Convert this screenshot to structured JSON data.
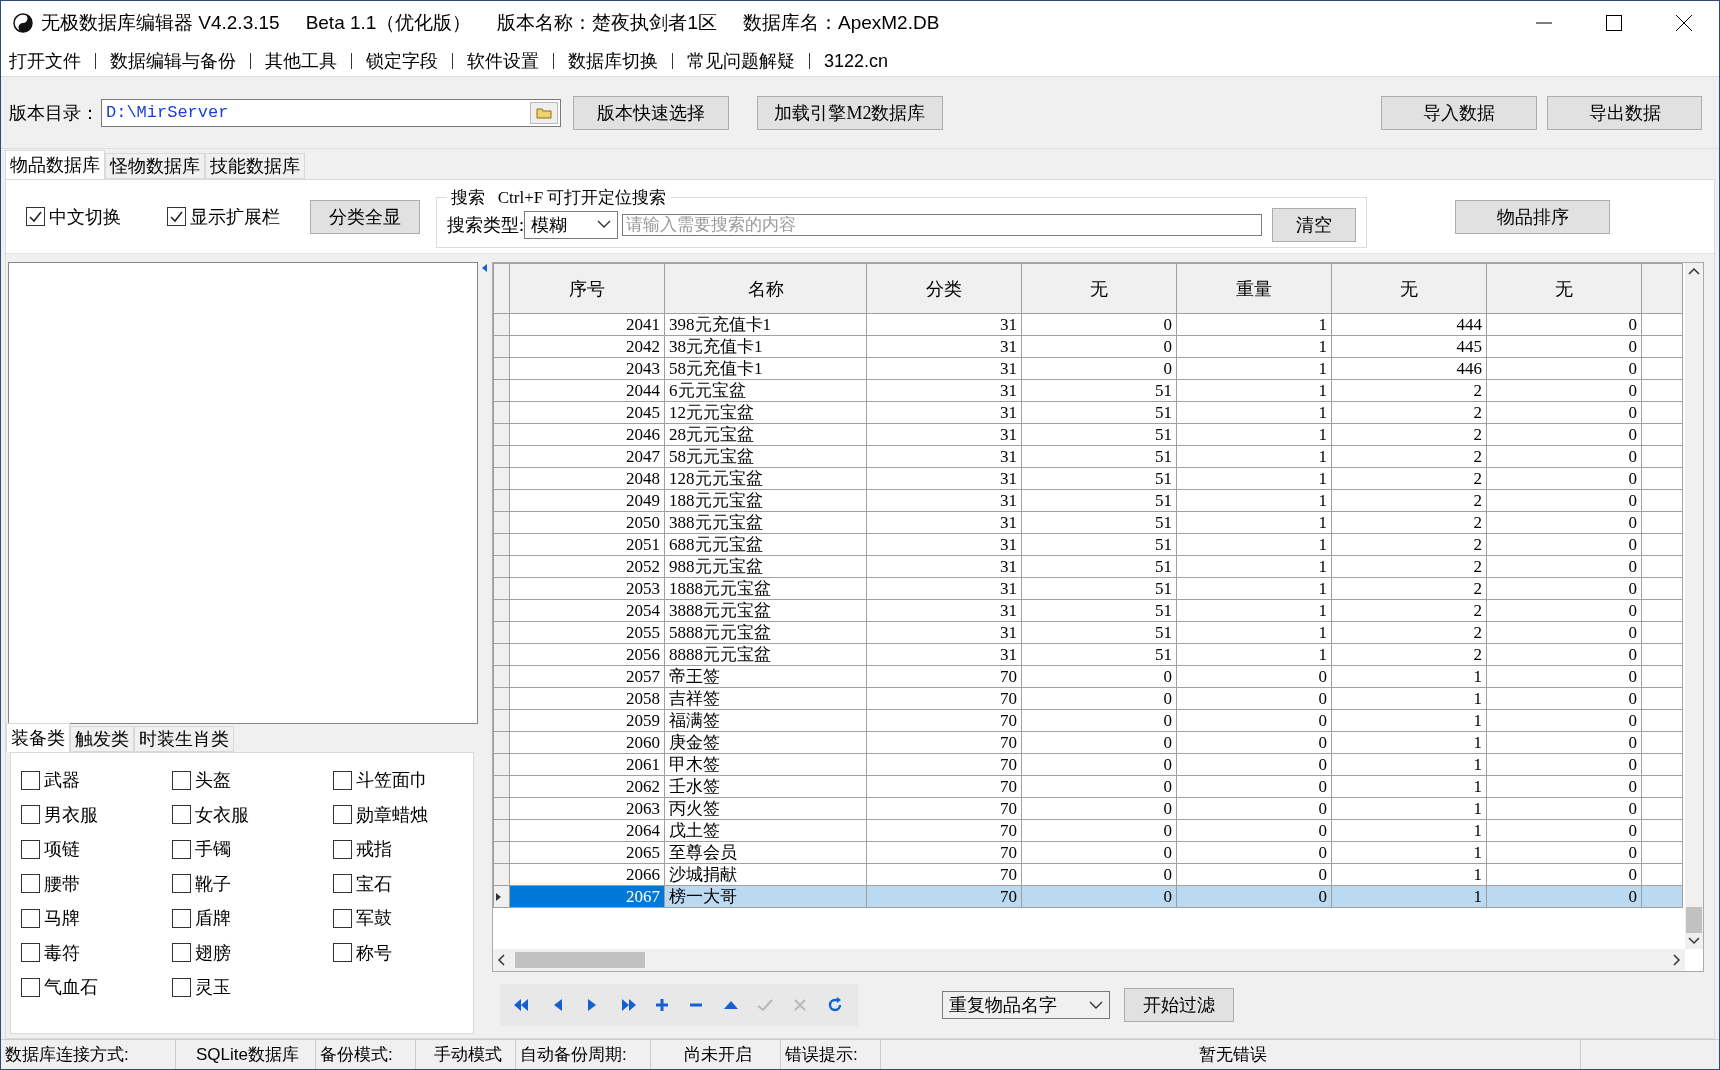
{
  "window": {
    "title_parts": [
      "无极数据库编辑器 V4.2.3.15",
      "Beta 1.1（优化版）",
      "版本名称：楚夜执剑者1区",
      "数据库名：ApexM2.DB"
    ]
  },
  "menu": [
    "打开文件",
    "数据编辑与备份",
    "其他工具",
    "锁定字段",
    "软件设置",
    "数据库切换",
    "常见问题解疑",
    "3122.cn"
  ],
  "toolbar": {
    "path_label": "版本目录：",
    "path_value": "D:\\MirServer",
    "buttons": [
      "版本快速选择",
      "加载引擎M2数据库"
    ],
    "right_buttons": [
      "导入数据",
      "导出数据"
    ]
  },
  "tabs": [
    {
      "label": "物品数据库",
      "selected": true
    },
    {
      "label": "怪物数据库",
      "selected": false
    },
    {
      "label": "技能数据库",
      "selected": false
    }
  ],
  "options": [
    {
      "label": "中文切换",
      "checked": true
    },
    {
      "label": "显示扩展栏",
      "checked": true
    }
  ],
  "show_all_button": "分类全显",
  "search": {
    "legend_label": "搜索",
    "legend_hint": "Ctrl+F 可打开定位搜索",
    "type_label": "搜索类型:",
    "type_value": "模糊",
    "placeholder": "请输入需要搜索的内容",
    "clear_button": "清空"
  },
  "sort_button": "物品排序",
  "category_tabs": [
    {
      "label": "装备类",
      "selected": true
    },
    {
      "label": "触发类",
      "selected": false
    },
    {
      "label": "时装生肖类",
      "selected": false
    }
  ],
  "categories": [
    {
      "label": "武器",
      "checked": false
    },
    {
      "label": "头盔",
      "checked": false
    },
    {
      "label": "斗笠面巾",
      "checked": false
    },
    {
      "label": "男衣服",
      "checked": false
    },
    {
      "label": "女衣服",
      "checked": false
    },
    {
      "label": "勋章蜡烛",
      "checked": false
    },
    {
      "label": "项链",
      "checked": false
    },
    {
      "label": "手镯",
      "checked": false
    },
    {
      "label": "戒指",
      "checked": false
    },
    {
      "label": "腰带",
      "checked": false
    },
    {
      "label": "靴子",
      "checked": false
    },
    {
      "label": "宝石",
      "checked": false
    },
    {
      "label": "马牌",
      "checked": false
    },
    {
      "label": "盾牌",
      "checked": false
    },
    {
      "label": "军鼓",
      "checked": false
    },
    {
      "label": "毒符",
      "checked": false
    },
    {
      "label": "翅膀",
      "checked": false
    },
    {
      "label": "称号",
      "checked": false
    },
    {
      "label": "气血石",
      "checked": false
    },
    {
      "label": "灵玉",
      "checked": false
    }
  ],
  "table": {
    "columns": [
      "序号",
      "名称",
      "分类",
      "无",
      "重量",
      "无",
      "无"
    ],
    "rows": [
      {
        "cells": [
          "2041",
          "398元充值卡1",
          "31",
          "0",
          "1",
          "444",
          "0"
        ],
        "selected": false
      },
      {
        "cells": [
          "2042",
          "38元充值卡1",
          "31",
          "0",
          "1",
          "445",
          "0"
        ],
        "selected": false
      },
      {
        "cells": [
          "2043",
          "58元充值卡1",
          "31",
          "0",
          "1",
          "446",
          "0"
        ],
        "selected": false
      },
      {
        "cells": [
          "2044",
          "6元元宝盆",
          "31",
          "51",
          "1",
          "2",
          "0"
        ],
        "selected": false
      },
      {
        "cells": [
          "2045",
          "12元元宝盆",
          "31",
          "51",
          "1",
          "2",
          "0"
        ],
        "selected": false
      },
      {
        "cells": [
          "2046",
          "28元元宝盆",
          "31",
          "51",
          "1",
          "2",
          "0"
        ],
        "selected": false
      },
      {
        "cells": [
          "2047",
          "58元元宝盆",
          "31",
          "51",
          "1",
          "2",
          "0"
        ],
        "selected": false
      },
      {
        "cells": [
          "2048",
          "128元元宝盆",
          "31",
          "51",
          "1",
          "2",
          "0"
        ],
        "selected": false
      },
      {
        "cells": [
          "2049",
          "188元元宝盆",
          "31",
          "51",
          "1",
          "2",
          "0"
        ],
        "selected": false
      },
      {
        "cells": [
          "2050",
          "388元元宝盆",
          "31",
          "51",
          "1",
          "2",
          "0"
        ],
        "selected": false
      },
      {
        "cells": [
          "2051",
          "688元元宝盆",
          "31",
          "51",
          "1",
          "2",
          "0"
        ],
        "selected": false
      },
      {
        "cells": [
          "2052",
          "988元元宝盆",
          "31",
          "51",
          "1",
          "2",
          "0"
        ],
        "selected": false
      },
      {
        "cells": [
          "2053",
          "1888元元宝盆",
          "31",
          "51",
          "1",
          "2",
          "0"
        ],
        "selected": false
      },
      {
        "cells": [
          "2054",
          "3888元元宝盆",
          "31",
          "51",
          "1",
          "2",
          "0"
        ],
        "selected": false
      },
      {
        "cells": [
          "2055",
          "5888元元宝盆",
          "31",
          "51",
          "1",
          "2",
          "0"
        ],
        "selected": false
      },
      {
        "cells": [
          "2056",
          "8888元元宝盆",
          "31",
          "51",
          "1",
          "2",
          "0"
        ],
        "selected": false
      },
      {
        "cells": [
          "2057",
          "帝王签",
          "70",
          "0",
          "0",
          "1",
          "0"
        ],
        "selected": false
      },
      {
        "cells": [
          "2058",
          "吉祥签",
          "70",
          "0",
          "0",
          "1",
          "0"
        ],
        "selected": false
      },
      {
        "cells": [
          "2059",
          "福满签",
          "70",
          "0",
          "0",
          "1",
          "0"
        ],
        "selected": false
      },
      {
        "cells": [
          "2060",
          "庚金签",
          "70",
          "0",
          "0",
          "1",
          "0"
        ],
        "selected": false
      },
      {
        "cells": [
          "2061",
          "甲木签",
          "70",
          "0",
          "0",
          "1",
          "0"
        ],
        "selected": false
      },
      {
        "cells": [
          "2062",
          "壬水签",
          "70",
          "0",
          "0",
          "1",
          "0"
        ],
        "selected": false
      },
      {
        "cells": [
          "2063",
          "丙火签",
          "70",
          "0",
          "0",
          "1",
          "0"
        ],
        "selected": false
      },
      {
        "cells": [
          "2064",
          "戊土签",
          "70",
          "0",
          "0",
          "1",
          "0"
        ],
        "selected": false
      },
      {
        "cells": [
          "2065",
          "至尊会员",
          "70",
          "0",
          "0",
          "1",
          "0"
        ],
        "selected": false
      },
      {
        "cells": [
          "2066",
          "沙城捐献",
          "70",
          "0",
          "0",
          "1",
          "0"
        ],
        "selected": false
      },
      {
        "cells": [
          "2067",
          "榜一大哥",
          "70",
          "0",
          "0",
          "1",
          "0"
        ],
        "selected": true
      }
    ]
  },
  "navigator": [
    {
      "kind": "first",
      "disabled": false
    },
    {
      "kind": "prior",
      "disabled": false
    },
    {
      "kind": "next",
      "disabled": false
    },
    {
      "kind": "last",
      "disabled": false
    },
    {
      "kind": "insert",
      "disabled": false
    },
    {
      "kind": "delete",
      "disabled": false
    },
    {
      "kind": "edit",
      "disabled": false
    },
    {
      "kind": "post",
      "disabled": true
    },
    {
      "kind": "cancel",
      "disabled": true
    },
    {
      "kind": "refresh",
      "disabled": false
    }
  ],
  "filter": {
    "value": "重复物品名字",
    "button": "开始过滤"
  },
  "status_bar": [
    {
      "label": "数据库连接方式:",
      "value": "SQLite数据库"
    },
    {
      "label": "备份模式:",
      "value": "手动模式"
    },
    {
      "label": "自动备份周期:",
      "value": "尚未开启"
    },
    {
      "label": "错误提示:",
      "value": "暂无错误"
    }
  ]
}
